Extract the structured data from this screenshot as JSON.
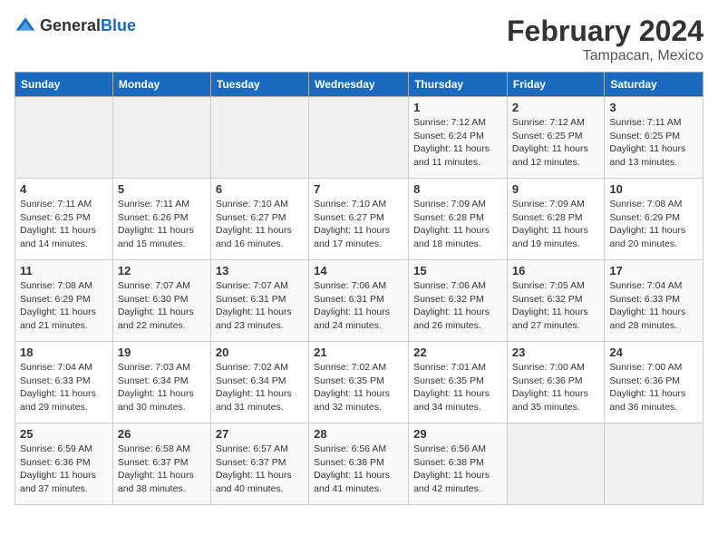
{
  "header": {
    "logo_general": "General",
    "logo_blue": "Blue",
    "month_year": "February 2024",
    "location": "Tampacan, Mexico"
  },
  "columns": [
    "Sunday",
    "Monday",
    "Tuesday",
    "Wednesday",
    "Thursday",
    "Friday",
    "Saturday"
  ],
  "weeks": [
    [
      {
        "day": "",
        "info": ""
      },
      {
        "day": "",
        "info": ""
      },
      {
        "day": "",
        "info": ""
      },
      {
        "day": "",
        "info": ""
      },
      {
        "day": "1",
        "info": "Sunrise: 7:12 AM\nSunset: 6:24 PM\nDaylight: 11 hours and 11 minutes."
      },
      {
        "day": "2",
        "info": "Sunrise: 7:12 AM\nSunset: 6:25 PM\nDaylight: 11 hours and 12 minutes."
      },
      {
        "day": "3",
        "info": "Sunrise: 7:11 AM\nSunset: 6:25 PM\nDaylight: 11 hours and 13 minutes."
      }
    ],
    [
      {
        "day": "4",
        "info": "Sunrise: 7:11 AM\nSunset: 6:25 PM\nDaylight: 11 hours and 14 minutes."
      },
      {
        "day": "5",
        "info": "Sunrise: 7:11 AM\nSunset: 6:26 PM\nDaylight: 11 hours and 15 minutes."
      },
      {
        "day": "6",
        "info": "Sunrise: 7:10 AM\nSunset: 6:27 PM\nDaylight: 11 hours and 16 minutes."
      },
      {
        "day": "7",
        "info": "Sunrise: 7:10 AM\nSunset: 6:27 PM\nDaylight: 11 hours and 17 minutes."
      },
      {
        "day": "8",
        "info": "Sunrise: 7:09 AM\nSunset: 6:28 PM\nDaylight: 11 hours and 18 minutes."
      },
      {
        "day": "9",
        "info": "Sunrise: 7:09 AM\nSunset: 6:28 PM\nDaylight: 11 hours and 19 minutes."
      },
      {
        "day": "10",
        "info": "Sunrise: 7:08 AM\nSunset: 6:29 PM\nDaylight: 11 hours and 20 minutes."
      }
    ],
    [
      {
        "day": "11",
        "info": "Sunrise: 7:08 AM\nSunset: 6:29 PM\nDaylight: 11 hours and 21 minutes."
      },
      {
        "day": "12",
        "info": "Sunrise: 7:07 AM\nSunset: 6:30 PM\nDaylight: 11 hours and 22 minutes."
      },
      {
        "day": "13",
        "info": "Sunrise: 7:07 AM\nSunset: 6:31 PM\nDaylight: 11 hours and 23 minutes."
      },
      {
        "day": "14",
        "info": "Sunrise: 7:06 AM\nSunset: 6:31 PM\nDaylight: 11 hours and 24 minutes."
      },
      {
        "day": "15",
        "info": "Sunrise: 7:06 AM\nSunset: 6:32 PM\nDaylight: 11 hours and 26 minutes."
      },
      {
        "day": "16",
        "info": "Sunrise: 7:05 AM\nSunset: 6:32 PM\nDaylight: 11 hours and 27 minutes."
      },
      {
        "day": "17",
        "info": "Sunrise: 7:04 AM\nSunset: 6:33 PM\nDaylight: 11 hours and 28 minutes."
      }
    ],
    [
      {
        "day": "18",
        "info": "Sunrise: 7:04 AM\nSunset: 6:33 PM\nDaylight: 11 hours and 29 minutes."
      },
      {
        "day": "19",
        "info": "Sunrise: 7:03 AM\nSunset: 6:34 PM\nDaylight: 11 hours and 30 minutes."
      },
      {
        "day": "20",
        "info": "Sunrise: 7:02 AM\nSunset: 6:34 PM\nDaylight: 11 hours and 31 minutes."
      },
      {
        "day": "21",
        "info": "Sunrise: 7:02 AM\nSunset: 6:35 PM\nDaylight: 11 hours and 32 minutes."
      },
      {
        "day": "22",
        "info": "Sunrise: 7:01 AM\nSunset: 6:35 PM\nDaylight: 11 hours and 34 minutes."
      },
      {
        "day": "23",
        "info": "Sunrise: 7:00 AM\nSunset: 6:36 PM\nDaylight: 11 hours and 35 minutes."
      },
      {
        "day": "24",
        "info": "Sunrise: 7:00 AM\nSunset: 6:36 PM\nDaylight: 11 hours and 36 minutes."
      }
    ],
    [
      {
        "day": "25",
        "info": "Sunrise: 6:59 AM\nSunset: 6:36 PM\nDaylight: 11 hours and 37 minutes."
      },
      {
        "day": "26",
        "info": "Sunrise: 6:58 AM\nSunset: 6:37 PM\nDaylight: 11 hours and 38 minutes."
      },
      {
        "day": "27",
        "info": "Sunrise: 6:57 AM\nSunset: 6:37 PM\nDaylight: 11 hours and 40 minutes."
      },
      {
        "day": "28",
        "info": "Sunrise: 6:56 AM\nSunset: 6:38 PM\nDaylight: 11 hours and 41 minutes."
      },
      {
        "day": "29",
        "info": "Sunrise: 6:56 AM\nSunset: 6:38 PM\nDaylight: 11 hours and 42 minutes."
      },
      {
        "day": "",
        "info": ""
      },
      {
        "day": "",
        "info": ""
      }
    ]
  ]
}
